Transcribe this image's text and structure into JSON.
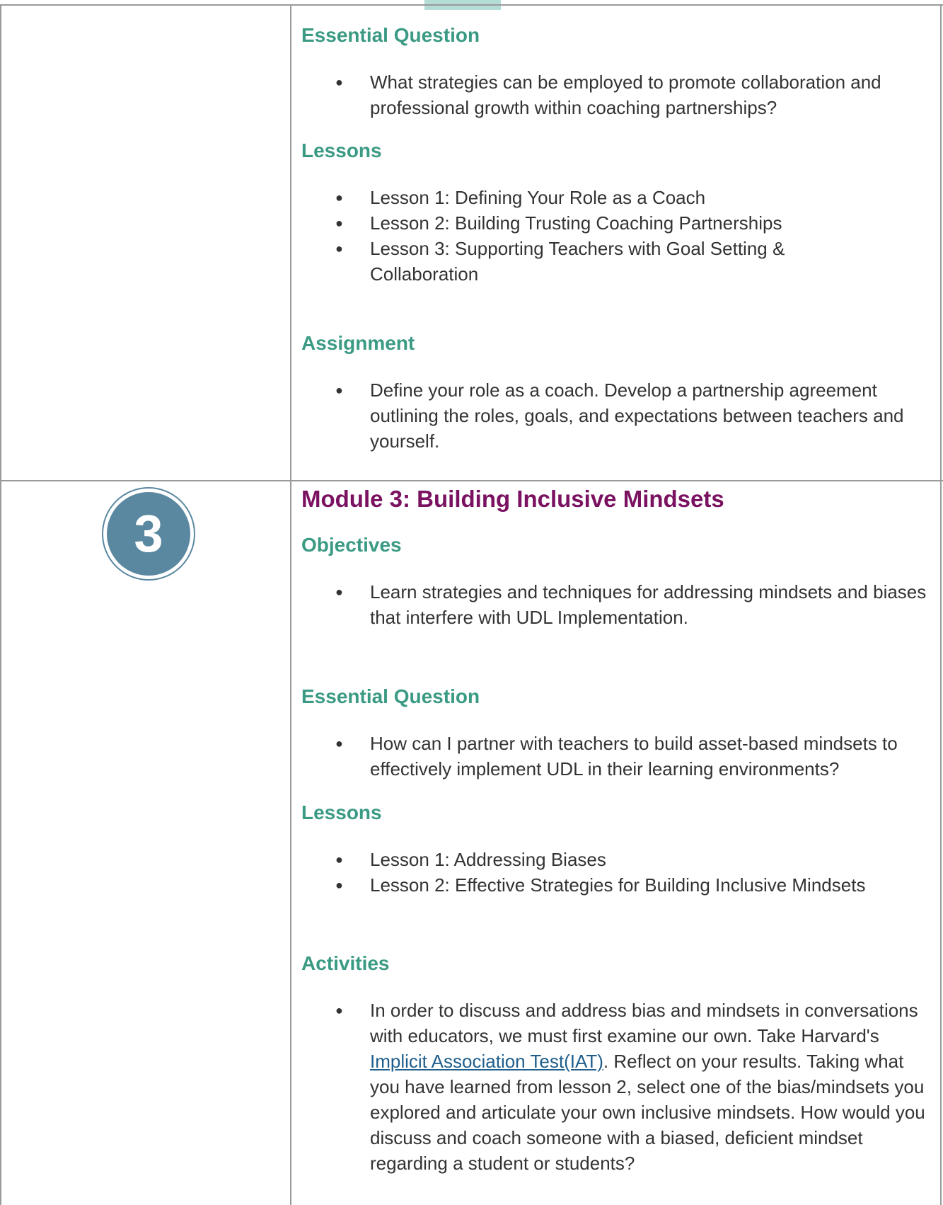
{
  "module2_continued": {
    "essential_question": {
      "heading": "Essential Question",
      "items": [
        "What strategies can be employed to promote collaboration and professional growth within coaching partnerships?"
      ]
    },
    "lessons": {
      "heading": "Lessons",
      "items": [
        "Lesson 1: Defining Your Role as a Coach",
        "Lesson 2: Building Trusting Coaching Partnerships",
        "Lesson 3: Supporting Teachers with Goal Setting & Collaboration"
      ]
    },
    "assignment": {
      "heading": "Assignment",
      "items": [
        "Define your role as a coach. Develop a partnership agreement outlining the roles, goals, and expectations between teachers and yourself."
      ]
    }
  },
  "module3": {
    "badge_number": "3",
    "title": "Module 3: Building Inclusive Mindsets",
    "objectives": {
      "heading": "Objectives",
      "items": [
        "Learn strategies and techniques for addressing mindsets and biases that interfere with UDL Implementation."
      ]
    },
    "essential_question": {
      "heading": "Essential Question",
      "items": [
        "How can I partner with teachers to build asset-based mindsets to effectively implement UDL in their learning environments?"
      ]
    },
    "lessons": {
      "heading": "Lessons",
      "items": [
        "Lesson 1: Addressing Biases",
        "Lesson 2: Effective Strategies for Building Inclusive Mindsets"
      ]
    },
    "activities": {
      "heading": "Activities",
      "text_before_link": "In order to discuss and address bias and mindsets in conversations with educators, we must first examine our own. Take Harvard's",
      "link_text": " Implicit Association Test(IAT)",
      "text_after_link": ". Reflect on your results. Taking what you have learned from lesson 2, select one of the bias/mindsets you explored and articulate your own inclusive mindsets. How would you discuss and coach someone with a biased, deficient mindset regarding a student or students?"
    }
  },
  "colors": {
    "section_heading": "#3a9a83",
    "module_title": "#7a1261",
    "badge": "#5a88a0",
    "link": "#1f5e8c",
    "tab_accent": "#b5ddd7"
  }
}
